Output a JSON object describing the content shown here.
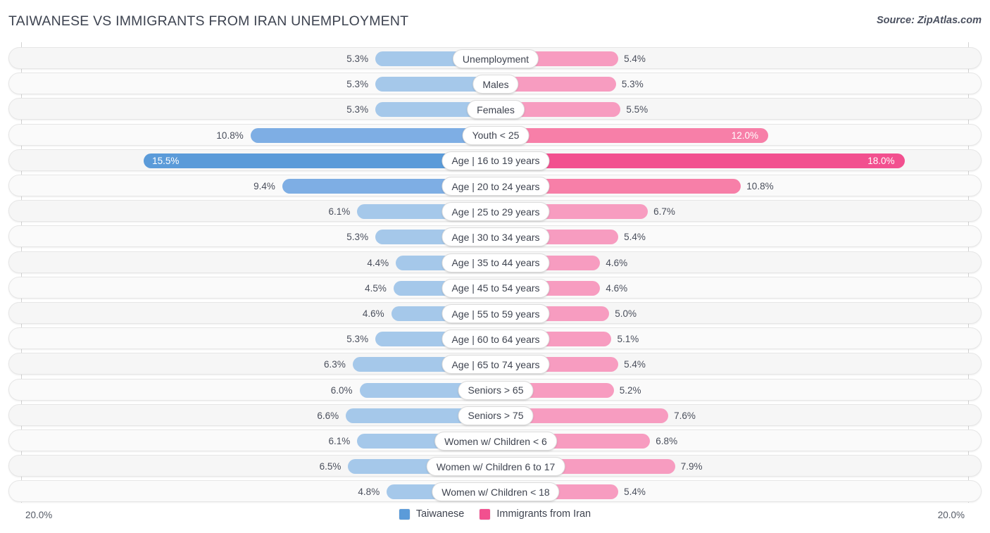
{
  "header": {
    "title": "TAIWANESE VS IMMIGRANTS FROM IRAN UNEMPLOYMENT",
    "source": "Source: ZipAtlas.com"
  },
  "axis": {
    "left_label": "20.0%",
    "right_label": "20.0%",
    "max": 20.0
  },
  "legend": [
    {
      "label": "Taiwanese",
      "color": "#5b9bd9"
    },
    {
      "label": "Immigrants from Iran",
      "color": "#f2508f"
    }
  ],
  "palette": {
    "blue_light": "#a5c8ea",
    "blue_mid": "#7eaee4",
    "blue_dark": "#5b9bd9",
    "pink_light": "#f79cc0",
    "pink_mid": "#f77fa8",
    "pink_dark": "#f2508f",
    "track": "#f6f6f6",
    "track_alt": "#fafafa"
  },
  "chart_data": {
    "type": "bar",
    "subtype": "diverging-bar",
    "title": "TAIWANESE VS IMMIGRANTS FROM IRAN UNEMPLOYMENT",
    "xlabel": "",
    "ylabel": "",
    "xlim": [
      20.0,
      20.0
    ],
    "grid": false,
    "legend_position": "bottom-center",
    "categories": [
      "Unemployment",
      "Males",
      "Females",
      "Youth < 25",
      "Age | 16 to 19 years",
      "Age | 20 to 24 years",
      "Age | 25 to 29 years",
      "Age | 30 to 34 years",
      "Age | 35 to 44 years",
      "Age | 45 to 54 years",
      "Age | 55 to 59 years",
      "Age | 60 to 64 years",
      "Age | 65 to 74 years",
      "Seniors > 65",
      "Seniors > 75",
      "Women w/ Children < 6",
      "Women w/ Children 6 to 17",
      "Women w/ Children < 18"
    ],
    "series": [
      {
        "name": "Taiwanese",
        "side": "left",
        "values": [
          5.3,
          5.3,
          5.3,
          10.8,
          15.5,
          9.4,
          6.1,
          5.3,
          4.4,
          4.5,
          4.6,
          5.3,
          6.3,
          6.0,
          6.6,
          6.1,
          6.5,
          4.8
        ]
      },
      {
        "name": "Immigrants from Iran",
        "side": "right",
        "values": [
          5.4,
          5.3,
          5.5,
          12.0,
          18.0,
          10.8,
          6.7,
          5.4,
          4.6,
          4.6,
          5.0,
          5.1,
          5.4,
          5.2,
          7.6,
          6.8,
          7.9,
          5.4
        ]
      }
    ]
  },
  "rows": [
    {
      "label": "Unemployment",
      "left": "5.3%",
      "right": "5.4%",
      "left_val": 5.3,
      "right_val": 5.4,
      "tier": "light",
      "left_inside": false,
      "right_inside": false
    },
    {
      "label": "Males",
      "left": "5.3%",
      "right": "5.3%",
      "left_val": 5.3,
      "right_val": 5.3,
      "tier": "light",
      "left_inside": false,
      "right_inside": false
    },
    {
      "label": "Females",
      "left": "5.3%",
      "right": "5.5%",
      "left_val": 5.3,
      "right_val": 5.5,
      "tier": "light",
      "left_inside": false,
      "right_inside": false
    },
    {
      "label": "Youth < 25",
      "left": "10.8%",
      "right": "12.0%",
      "left_val": 10.8,
      "right_val": 12.0,
      "tier": "mid",
      "left_inside": false,
      "right_inside": true
    },
    {
      "label": "Age | 16 to 19 years",
      "left": "15.5%",
      "right": "18.0%",
      "left_val": 15.5,
      "right_val": 18.0,
      "tier": "dark",
      "left_inside": true,
      "right_inside": true
    },
    {
      "label": "Age | 20 to 24 years",
      "left": "9.4%",
      "right": "10.8%",
      "left_val": 9.4,
      "right_val": 10.8,
      "tier": "mid",
      "left_inside": false,
      "right_inside": false
    },
    {
      "label": "Age | 25 to 29 years",
      "left": "6.1%",
      "right": "6.7%",
      "left_val": 6.1,
      "right_val": 6.7,
      "tier": "light",
      "left_inside": false,
      "right_inside": false
    },
    {
      "label": "Age | 30 to 34 years",
      "left": "5.3%",
      "right": "5.4%",
      "left_val": 5.3,
      "right_val": 5.4,
      "tier": "light",
      "left_inside": false,
      "right_inside": false
    },
    {
      "label": "Age | 35 to 44 years",
      "left": "4.4%",
      "right": "4.6%",
      "left_val": 4.4,
      "right_val": 4.6,
      "tier": "light",
      "left_inside": false,
      "right_inside": false
    },
    {
      "label": "Age | 45 to 54 years",
      "left": "4.5%",
      "right": "4.6%",
      "left_val": 4.5,
      "right_val": 4.6,
      "tier": "light",
      "left_inside": false,
      "right_inside": false
    },
    {
      "label": "Age | 55 to 59 years",
      "left": "4.6%",
      "right": "5.0%",
      "left_val": 4.6,
      "right_val": 5.0,
      "tier": "light",
      "left_inside": false,
      "right_inside": false
    },
    {
      "label": "Age | 60 to 64 years",
      "left": "5.3%",
      "right": "5.1%",
      "left_val": 5.3,
      "right_val": 5.1,
      "tier": "light",
      "left_inside": false,
      "right_inside": false
    },
    {
      "label": "Age | 65 to 74 years",
      "left": "6.3%",
      "right": "5.4%",
      "left_val": 6.3,
      "right_val": 5.4,
      "tier": "light",
      "left_inside": false,
      "right_inside": false
    },
    {
      "label": "Seniors > 65",
      "left": "6.0%",
      "right": "5.2%",
      "left_val": 6.0,
      "right_val": 5.2,
      "tier": "light",
      "left_inside": false,
      "right_inside": false
    },
    {
      "label": "Seniors > 75",
      "left": "6.6%",
      "right": "7.6%",
      "left_val": 6.6,
      "right_val": 7.6,
      "tier": "light",
      "left_inside": false,
      "right_inside": false
    },
    {
      "label": "Women w/ Children < 6",
      "left": "6.1%",
      "right": "6.8%",
      "left_val": 6.1,
      "right_val": 6.8,
      "tier": "light",
      "left_inside": false,
      "right_inside": false
    },
    {
      "label": "Women w/ Children 6 to 17",
      "left": "6.5%",
      "right": "7.9%",
      "left_val": 6.5,
      "right_val": 7.9,
      "tier": "light",
      "left_inside": false,
      "right_inside": false
    },
    {
      "label": "Women w/ Children < 18",
      "left": "4.8%",
      "right": "5.4%",
      "left_val": 4.8,
      "right_val": 5.4,
      "tier": "light",
      "left_inside": false,
      "right_inside": false
    }
  ]
}
